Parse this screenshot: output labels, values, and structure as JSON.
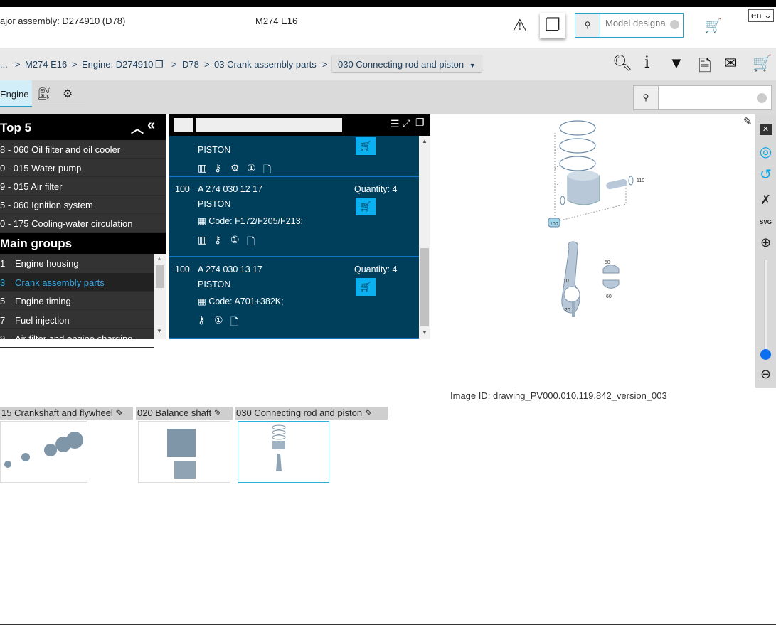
{
  "header": {
    "assembly": "ajor assembly: D274910 (D78)",
    "model": "M274 E16",
    "search_placeholder": "Model designa",
    "language": "en"
  },
  "breadcrumb": {
    "items": [
      "...",
      "M274 E16",
      "Engine: D274910",
      "D78",
      "03 Crank assembly parts"
    ],
    "current": "030 Connecting rod and piston"
  },
  "tabs": {
    "engine": "Engine"
  },
  "top5": {
    "title": "Top 5",
    "items": [
      "8 - 060 Oil filter and oil cooler",
      "0 - 015 Water pump",
      "9 - 015 Air filter",
      "5 - 060 Ignition system",
      "0 - 175 Cooling-water circulation"
    ]
  },
  "main_groups": {
    "title": "Main groups",
    "items": [
      {
        "num": "1",
        "label": "Engine housing"
      },
      {
        "num": "3",
        "label": "Crank assembly parts",
        "selected": true
      },
      {
        "num": "5",
        "label": "Engine timing"
      },
      {
        "num": "7",
        "label": "Fuel injection"
      },
      {
        "num": "9",
        "label": "Air filter and engine charging"
      }
    ]
  },
  "parts": [
    {
      "pos": "",
      "number": "",
      "name": "PISTON",
      "code": "",
      "quantity": ""
    },
    {
      "pos": "100",
      "number": "A 274 030 12 17",
      "name": "PISTON",
      "code": "Code: F172/F205/F213;",
      "quantity": "Quantity: 4"
    },
    {
      "pos": "100",
      "number": "A 274 030 13 17",
      "name": "PISTON",
      "code": "Code: A701+382K;",
      "quantity": "Quantity: 4"
    }
  ],
  "drawing": {
    "image_id": "Image ID: drawing_PV000.010.119.842_version_003",
    "callouts": [
      "100",
      "110",
      "50",
      "10",
      "60",
      "20"
    ],
    "zoom_level": 0.05
  },
  "thumbnails": [
    "15 Crankshaft and flywheel",
    "020 Balance shaft",
    "030 Connecting rod and piston"
  ],
  "colors": {
    "accent": "#0ab0f0",
    "panel": "#003f5c",
    "selected": "#3aa8e0"
  }
}
